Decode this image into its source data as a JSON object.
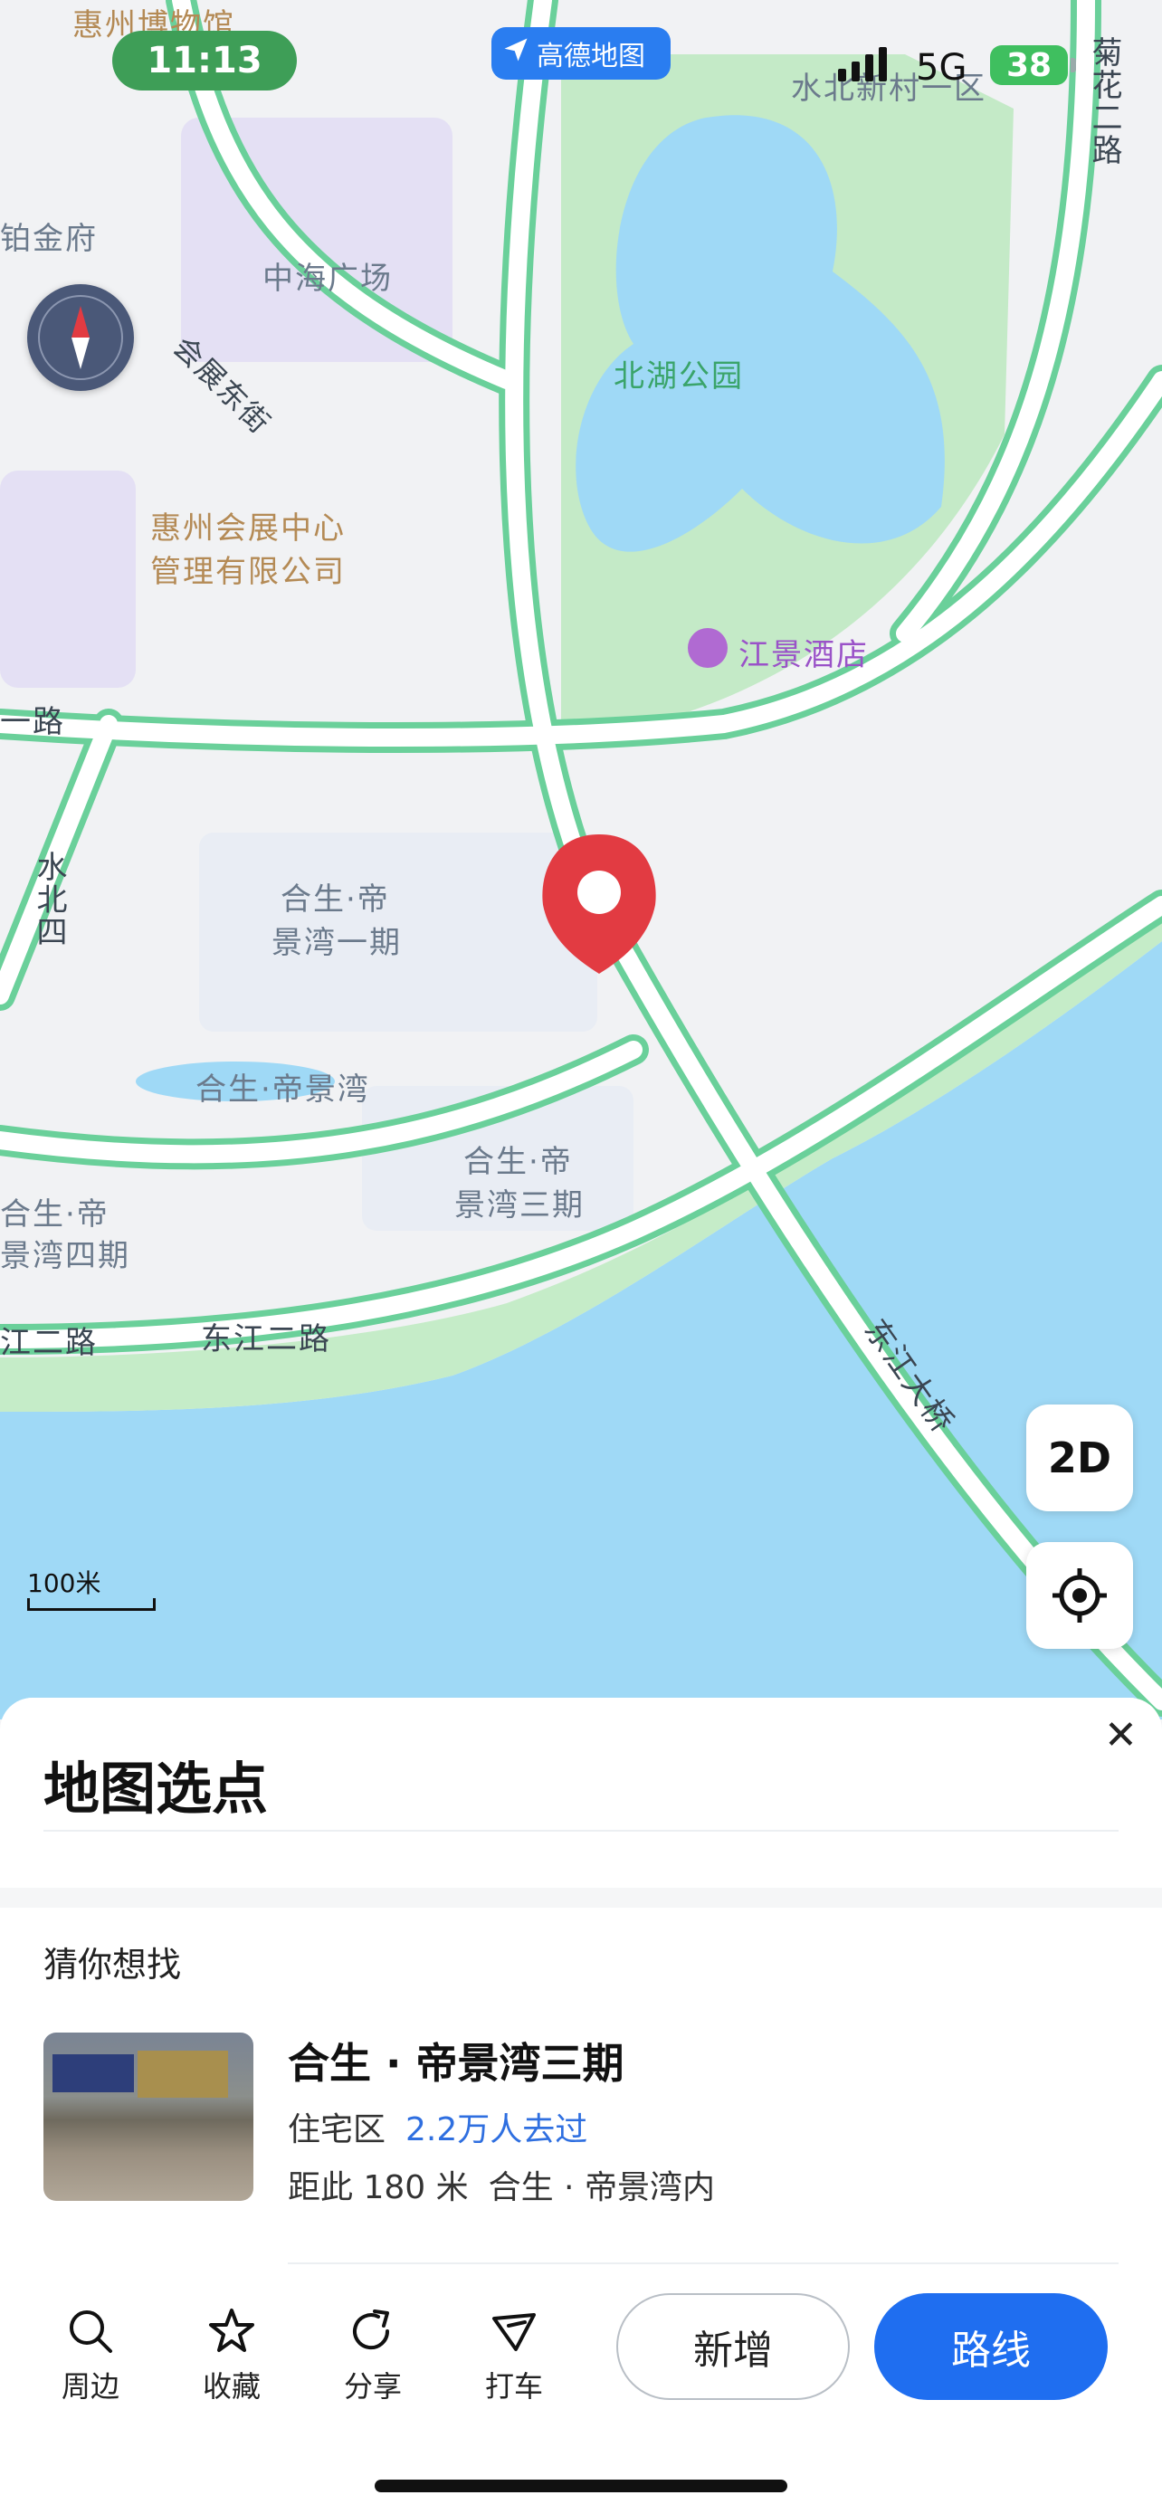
{
  "status_bar": {
    "time": "11:13",
    "network": "5G",
    "battery": "38"
  },
  "app_badge": {
    "label": "高德地图"
  },
  "map": {
    "labels": {
      "museum": "惠州博物馆",
      "bojin": "铂金府",
      "zhonghai": "中海广场",
      "huizhan_east": "会展东街",
      "beihu_park": "北湖公园",
      "expo_center": "惠州会展中心",
      "expo_center_2": "管理有限公司",
      "jiangjing_hotel": "江景酒店",
      "shuibei_village": "水北新村一区",
      "juhua_road": "菊花二路",
      "shuibei_road": "水北四",
      "yi_road": "一路",
      "hesheng_1": "合生·帝",
      "hesheng_1b": "景湾一期",
      "hesheng_main": "合生·帝景湾",
      "hesheng_3": "合生·帝",
      "hesheng_3b": "景湾三期",
      "hesheng_4": "合生·帝",
      "hesheng_4b": "景湾四期",
      "dongjiang_road_left": "江二路",
      "dongjiang_road": "东江二路",
      "dongjiang_bridge": "东江大桥"
    },
    "btn_2d": "2D",
    "scale_label": "100米",
    "colors": {
      "water": "#9fd9f6",
      "park": "#bfe6c4",
      "road_edge": "#6ad09a",
      "pin": "#e23b42"
    }
  },
  "sheet": {
    "title": "地图选点",
    "section_title": "猜你想找",
    "poi": {
      "name": "合生 · 帝景湾三期",
      "category": "住宅区",
      "visits": "2.2万人去过",
      "distance": "距此 180 米",
      "area": "合生 · 帝景湾内"
    }
  },
  "toolbar": {
    "nearby": "周边",
    "favorite": "收藏",
    "share": "分享",
    "taxi": "打车",
    "add": "新增",
    "route": "路线"
  }
}
